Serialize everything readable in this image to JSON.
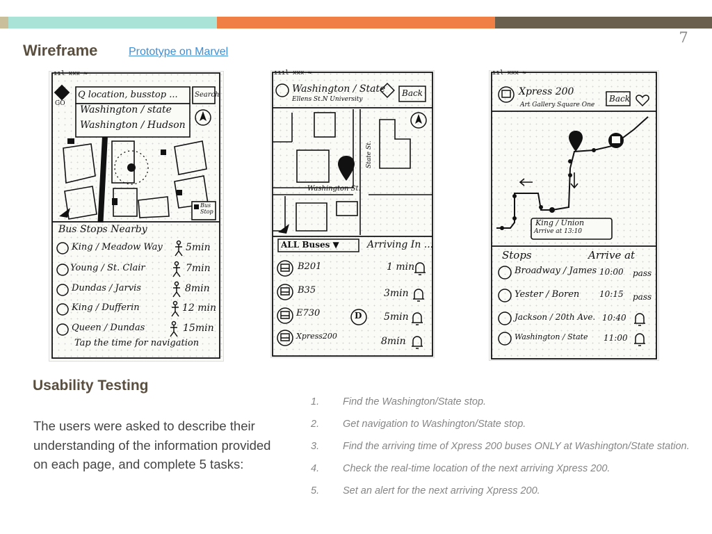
{
  "colors": {
    "bar": [
      "#c9bf9a",
      "#a9e3d8",
      "#ef7f45",
      "#6a5e4c"
    ],
    "title": "#5a4f3f",
    "link": "#3d8ed6"
  },
  "slide": {
    "page_number": "7",
    "title": "Wireframe",
    "prototype_link": "Prototype on Marvel"
  },
  "wire1": {
    "status": "ııl xxx ≈",
    "search_placeholder": "Q location, busstop ...",
    "search_button": "Search",
    "go_label": "GO",
    "suggestions": [
      "Washington / state",
      "Washington / Hudson"
    ],
    "bus_stop_legend": "Bus Stop",
    "section_title": "Bus Stops Nearby",
    "stops": [
      {
        "name": "King / Meadow Way",
        "time": "5min"
      },
      {
        "name": "Young / St. Clair",
        "time": "7min"
      },
      {
        "name": "Dundas / Jarvis",
        "time": "8min"
      },
      {
        "name": "King / Dufferin",
        "time": "12 min"
      },
      {
        "name": "Queen / Dundas",
        "time": "15min"
      }
    ],
    "footer": "Tap the time for navigation"
  },
  "wire2": {
    "status": "ıııl xxx ≈",
    "stop_name": "Washington / State",
    "cross_streets": "Ellens St.N  University",
    "back": "Back",
    "street_vertical": "State St.",
    "street_horizontal": "Washington St.",
    "filter": "ALL Buses ▼",
    "arriving_label": "Arriving In ...",
    "buses": [
      {
        "route": "B201",
        "time": "1 min"
      },
      {
        "route": "B35",
        "time": "3min"
      },
      {
        "route": "E730",
        "time": "5min",
        "badge": "D"
      },
      {
        "route": "Xpress200",
        "time": "8min"
      }
    ]
  },
  "wire3": {
    "status": "ııl xxx ≈",
    "route_name": "Xpress 200",
    "destinations": "Art Gallery  Square One",
    "back": "Back",
    "popup_stop": "King / Union",
    "popup_time": "Arrive at 13:10",
    "col_stops": "Stops",
    "col_arrive": "Arrive at",
    "stops": [
      {
        "name": "Broadway / James",
        "time": "10:00",
        "status": "pass"
      },
      {
        "name": "Yester / Boren",
        "time": "10:15",
        "status": "pass"
      },
      {
        "name": "Jackson / 20th Ave.",
        "time": "10:40",
        "status": "bell"
      },
      {
        "name": "Washington / State",
        "time": "11:00",
        "status": "bell"
      }
    ]
  },
  "testing": {
    "title": "Usability Testing",
    "description": "The users were asked to describe their understanding of the information provided on each page, and complete 5 tasks:",
    "tasks": [
      {
        "num": "1.",
        "text": "Find the Washington/State stop."
      },
      {
        "num": "2.",
        "text": "Get navigation to Washington/State stop."
      },
      {
        "num": "3.",
        "text": "Find the arriving time of Xpress 200 buses ONLY at Washington/State station."
      },
      {
        "num": "4.",
        "text": "Check the real-time location of the next arriving Xpress 200."
      },
      {
        "num": "5.",
        "text": "Set an alert for the next arriving Xpress 200."
      }
    ]
  }
}
